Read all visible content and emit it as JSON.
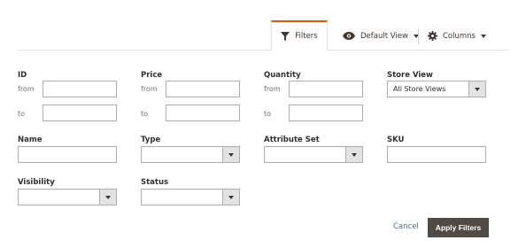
{
  "toolbar": {
    "filters_label": "Filters",
    "view_label": "Default View",
    "columns_label": "Columns"
  },
  "filters": {
    "id": {
      "label": "ID",
      "from_label": "from",
      "to_label": "to",
      "from_value": "",
      "to_value": ""
    },
    "price": {
      "label": "Price",
      "from_label": "from",
      "to_label": "to",
      "from_value": "",
      "to_value": ""
    },
    "quantity": {
      "label": "Quantity",
      "from_label": "from",
      "to_label": "to",
      "from_value": "",
      "to_value": ""
    },
    "store_view": {
      "label": "Store View",
      "value": "All Store Views"
    },
    "name": {
      "label": "Name",
      "value": ""
    },
    "type": {
      "label": "Type",
      "value": ""
    },
    "attribute_set": {
      "label": "Attribute Set",
      "value": ""
    },
    "sku": {
      "label": "SKU",
      "value": ""
    },
    "visibility": {
      "label": "Visibility",
      "value": ""
    },
    "status": {
      "label": "Status",
      "value": ""
    }
  },
  "actions": {
    "cancel_label": "Cancel",
    "apply_label": "Apply Filters"
  },
  "colors": {
    "accent_tab": "#eb5202",
    "apply_button": "#514943",
    "cancel_link": "#1979c3"
  },
  "icons": {
    "filters": "funnel-icon",
    "view": "eye-icon",
    "columns": "gear-icon",
    "caret": "caret-down-icon",
    "select_arrow": "caret-down-icon"
  }
}
